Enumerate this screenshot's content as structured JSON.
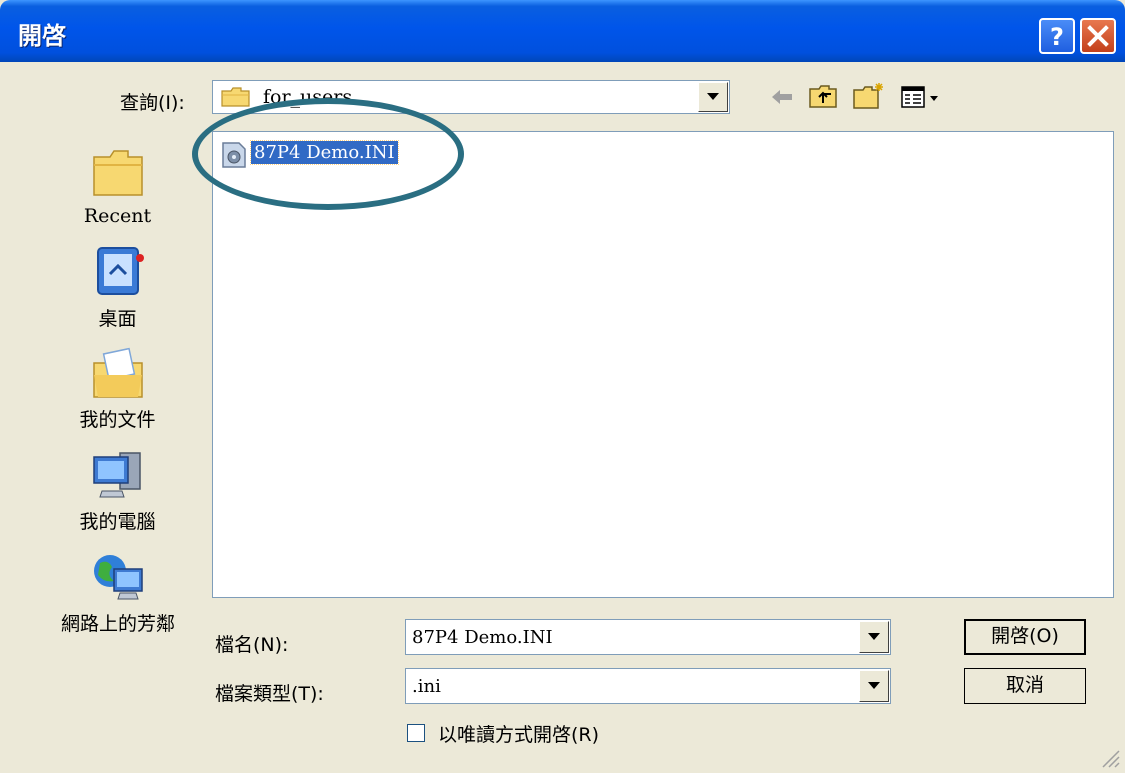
{
  "window": {
    "title": "開啓",
    "help_icon": "help-icon",
    "close_icon": "close-icon",
    "colors": {
      "titlebar": "#0055EA",
      "close": "#C3401B",
      "selection": "#316AC5",
      "highlight_circle": "#2A6E82"
    }
  },
  "lookin": {
    "label": "查詢(I):",
    "value": "for_users",
    "toolbar_icons": [
      "back-icon",
      "up-folder-icon",
      "new-folder-icon",
      "view-menu-icon"
    ]
  },
  "places": [
    {
      "label": "Recent",
      "icon": "recent-folder-icon"
    },
    {
      "label": "桌面",
      "icon": "desktop-icon"
    },
    {
      "label": "我的文件",
      "icon": "my-documents-icon"
    },
    {
      "label": "我的電腦",
      "icon": "my-computer-icon"
    },
    {
      "label": "網路上的芳鄰",
      "icon": "network-places-icon"
    }
  ],
  "files": [
    {
      "name": "87P4 Demo.INI",
      "icon": "ini-file-icon",
      "selected": true
    }
  ],
  "filename": {
    "label": "檔名(N):",
    "value": "87P4 Demo.INI"
  },
  "filetype": {
    "label": "檔案類型(T):",
    "value": ".ini"
  },
  "readonly": {
    "label": "以唯讀方式開啓(R)",
    "checked": false
  },
  "buttons": {
    "open": "開啓(O)",
    "cancel": "取消"
  }
}
